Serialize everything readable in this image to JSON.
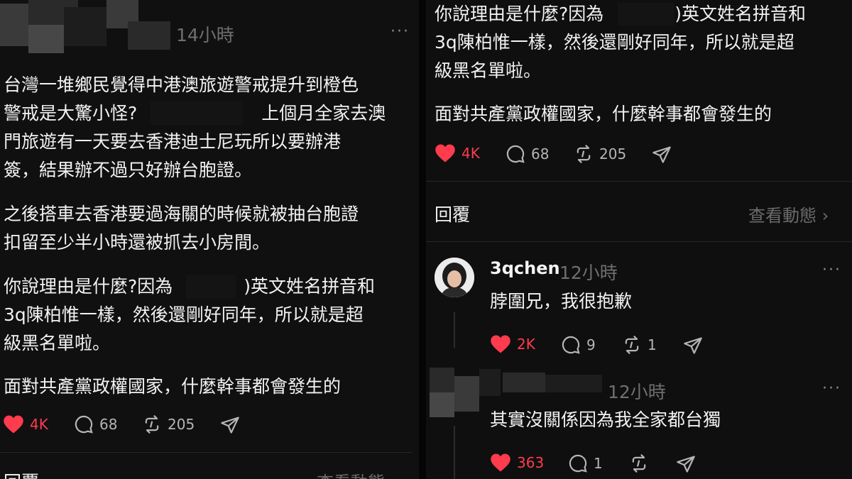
{
  "left_post": {
    "time": "14小時",
    "paragraphs": [
      "台灣一堆鄉民覺得中港澳旅遊警戒提升到橙色\n警戒是大驚小怪?　　　　　　　上個月全家去澳\n門旅遊有一天要去香港迪士尼玩所以要辦港\n簽，結果辦不過只好辦台胞證。",
      "之後搭車去香港要過海關的時候就被抽台胞證\n扣留至少半小時還被抓去小房間。",
      "你說理由是什麼?因為　　　　)英文姓名拼音和\n3q陳柏惟一樣，然後還剛好同年，所以就是超\n級黑名單啦。",
      "面對共產黨政權國家，什麼幹事都會發生的"
    ],
    "stats": {
      "likes": "4K",
      "comments": "68",
      "reposts": "205"
    },
    "reply_label": "回覆",
    "view_activity": "查看動態 ›"
  },
  "right_post": {
    "paragraphs": [
      "你說理由是什麼?因為　　　　)英文姓名拼音和\n3q陳柏惟一樣，然後還剛好同年，所以就是超\n級黑名單啦。",
      "面對共產黨政權國家，什麼幹事都會發生的"
    ],
    "stats": {
      "likes": "4K",
      "comments": "68",
      "reposts": "205"
    },
    "reply_label": "回覆",
    "view_activity": "查看動態 ›"
  },
  "replies": [
    {
      "username": "3qchen",
      "time": "12小時",
      "text": "脖圍兄，我很抱歉",
      "likes": "2K",
      "comments": "9",
      "reposts": "1"
    },
    {
      "username": "",
      "time": "12小時",
      "text": "其實沒關係因為我全家都台獨",
      "likes": "363",
      "comments": "1",
      "reposts": ""
    }
  ],
  "more_glyph": "···",
  "colors": {
    "like": "#ff3b4e",
    "muted": "#6f6f6f",
    "text": "#f2f2f2",
    "background": "#101010"
  },
  "icons": [
    "heart-icon",
    "comment-icon",
    "repost-icon",
    "share-icon",
    "more-icon"
  ]
}
